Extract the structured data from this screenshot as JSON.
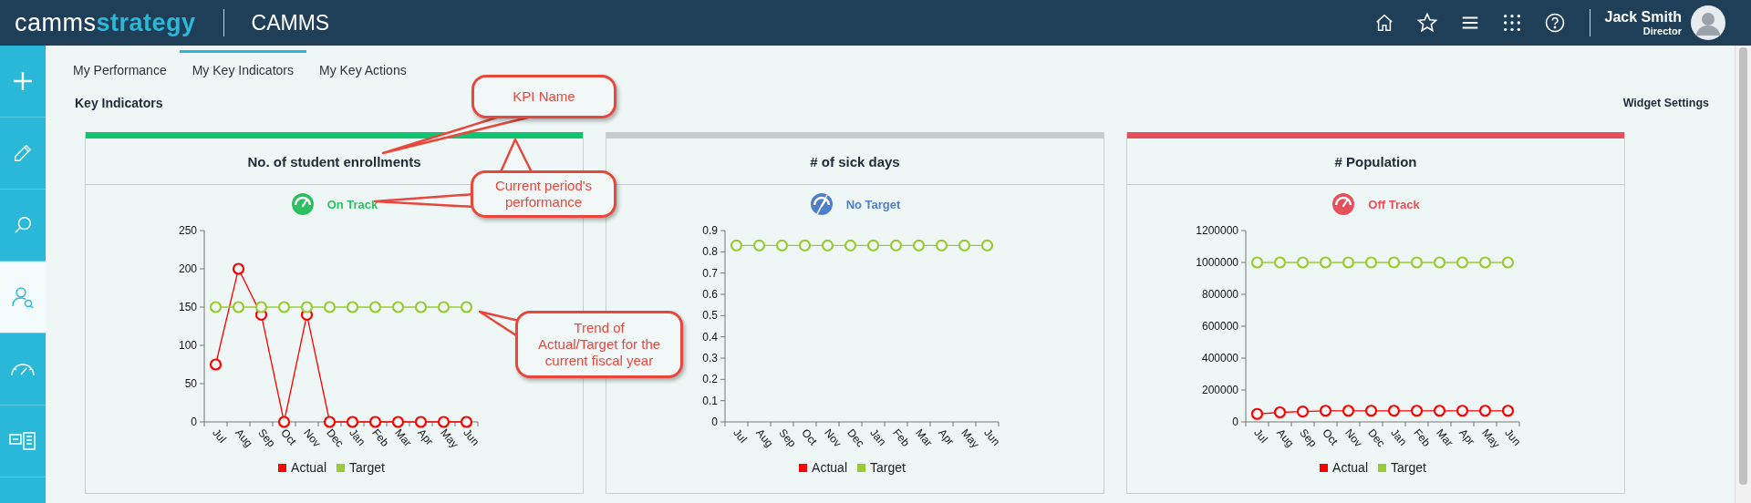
{
  "header": {
    "logo_light": "camms",
    "logo_bold": "strategy",
    "app_name": "CAMMS",
    "user": {
      "name": "Jack Smith",
      "role": "Director"
    }
  },
  "sidebar": {
    "items": [
      {
        "kind": "plus",
        "selected": false
      },
      {
        "kind": "pencil",
        "selected": false
      },
      {
        "kind": "search",
        "selected": false
      },
      {
        "kind": "person",
        "selected": true
      },
      {
        "kind": "gauge",
        "selected": false
      },
      {
        "kind": "cards",
        "selected": false
      }
    ]
  },
  "tabs": [
    {
      "label": "My Performance",
      "selected": false
    },
    {
      "label": "My Key Indicators",
      "selected": true
    },
    {
      "label": "My Key Actions",
      "selected": false
    }
  ],
  "section_title": "Key Indicators",
  "widget_settings": "Widget Settings",
  "cards": [
    {
      "title": "No. of student enrollments",
      "status": {
        "kind": "on_track",
        "label": "On Track"
      },
      "chart_data": {
        "type": "line",
        "categories": [
          "Jul",
          "Aug",
          "Sep",
          "Oct",
          "Nov",
          "Dec",
          "Jan",
          "Feb",
          "Mar",
          "Apr",
          "May",
          "Jun"
        ],
        "ylim": [
          0,
          250
        ],
        "yticks": [
          0,
          50,
          100,
          150,
          200,
          250
        ],
        "series": [
          {
            "name": "Actual",
            "color": "#ff0000",
            "marker": "circle",
            "values": [
              75,
              200,
              140,
              0,
              140,
              0,
              0,
              0,
              0,
              0,
              0,
              0
            ]
          },
          {
            "name": "Target",
            "color": "#99cc33",
            "marker": "circle",
            "values": [
              150,
              150,
              150,
              150,
              150,
              150,
              150,
              150,
              150,
              150,
              150,
              150
            ]
          }
        ]
      }
    },
    {
      "title": "# of sick days",
      "status": {
        "kind": "no_target",
        "label": "No Target"
      },
      "chart_data": {
        "type": "line",
        "categories": [
          "Jul",
          "Aug",
          "Sep",
          "Oct",
          "Nov",
          "Dec",
          "Jan",
          "Feb",
          "Mar",
          "Apr",
          "May",
          "Jun"
        ],
        "ylim": [
          0,
          0.9
        ],
        "yticks": [
          0,
          0.1,
          0.2,
          0.3,
          0.4,
          0.5,
          0.6,
          0.7,
          0.8,
          0.9
        ],
        "series": [
          {
            "name": "Actual",
            "color": "#ff0000",
            "values": [
              null,
              null,
              null,
              null,
              null,
              null,
              null,
              null,
              null,
              null,
              null,
              null
            ]
          },
          {
            "name": "Target",
            "color": "#99cc33",
            "marker": "circle",
            "values": [
              0.83,
              0.83,
              0.83,
              0.83,
              0.83,
              0.83,
              0.83,
              0.83,
              0.83,
              0.83,
              0.83,
              0.83
            ]
          }
        ]
      }
    },
    {
      "title": "# Population",
      "status": {
        "kind": "off_track",
        "label": "Off Track"
      },
      "chart_data": {
        "type": "line",
        "categories": [
          "Jul",
          "Aug",
          "Sep",
          "Oct",
          "Nov",
          "Dec",
          "Jan",
          "Feb",
          "Mar",
          "Apr",
          "May",
          "Jun"
        ],
        "ylim": [
          0,
          1200000
        ],
        "yticks": [
          0,
          200000,
          400000,
          600000,
          800000,
          1000000,
          1200000
        ],
        "series": [
          {
            "name": "Actual",
            "color": "#ff0000",
            "marker": "circle",
            "values": [
              50000,
              60000,
              65000,
              70000,
              70000,
              70000,
              70000,
              70000,
              70000,
              70000,
              70000,
              70000
            ]
          },
          {
            "name": "Target",
            "color": "#99cc33",
            "marker": "circle",
            "values": [
              1000000,
              1000000,
              1000000,
              1000000,
              1000000,
              1000000,
              1000000,
              1000000,
              1000000,
              1000000,
              1000000,
              1000000
            ]
          }
        ]
      }
    }
  ],
  "callouts": [
    {
      "text": "KPI Name"
    },
    {
      "text": "Current period's\nperformance"
    },
    {
      "text": "Trend of\nActual/Target for the\ncurrent fiscal year"
    }
  ]
}
